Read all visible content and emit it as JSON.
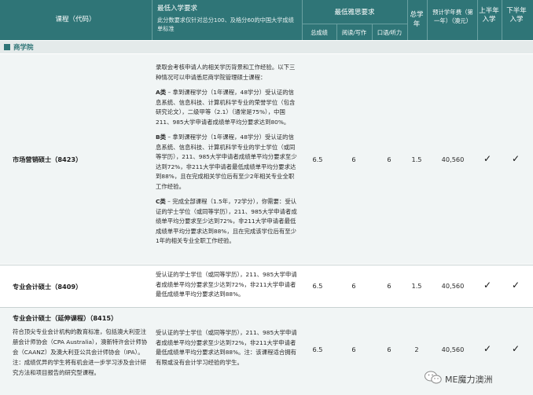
{
  "header": {
    "program": "课程（代码）",
    "min_entry": "最低入学要求",
    "min_entry_note": "此分数要求仅针对总分100、及格分60的中国大学成绩单标准",
    "ielts": "最低雅思要求",
    "overall": "总成绩",
    "reading_writing": "阅读/写作",
    "listening_speaking": "口语/听力",
    "total_years": "总学年",
    "tuition": "预计学年费（第一年）（澳元）",
    "h1": "上半年入学",
    "h2": "下半年入学"
  },
  "section": "商学院",
  "rows": [
    {
      "name": "市场营销硕士（8423）",
      "req_intro": "录取会考核申请人的相关学历背景和工作经验。以下三种情况可以申请悉尼商学院管理硕士课程：",
      "req_a_label": "A类",
      "req_a": " – 拿到课程学分（1年课程，48学分）受认证的信息系统、信息科技、计算机科学专业的荣誉学位（包含研究论文），二级甲等（2.1）（通常是75%），中国211、985大学申请者成绩单平均分要求达到80%。",
      "req_b_label": "B类",
      "req_b": " – 拿到课程学分（1年课程，48学分）受认证的信息系统、信息科技、计算机科学专业的学士学位（或同等学历），211、985大学申请者成绩单平均分要求至少达到72%，非211大学申请者最低成绩单平均分要求达到88%，且在完成相关学位后有至少2年相关专业全职工作经验。",
      "req_c_label": "C类",
      "req_c": " – 完成全部课程（1.5年，72学分），你需要：受认证的学士学位（或同等学历），211、985大学申请者成绩单平均分要求至少达到72%，非211大学申请者最低成绩单平均分要求达到88%，且在完成该学位后有至少1年的相关专业全职工作经验。",
      "overall": "6.5",
      "rw": "6",
      "ls": "6",
      "years": "1.5",
      "fee": "40,560",
      "h1": "✓",
      "h2": "✓"
    },
    {
      "name": "专业会计硕士（8409）",
      "req": "受认证的学士学位（或同等学历），211、985大学申请者成绩单平均分要求至少达到72%，非211大学申请者最低成绩单平均分要求达到88%。",
      "overall": "6.5",
      "rw": "6",
      "ls": "6",
      "years": "1.5",
      "fee": "40,560",
      "h1": "✓",
      "h2": "✓"
    },
    {
      "name": "专业会计硕士（延伸课程）（8415）",
      "desc": "符合顶尖专业会计机构的教育标准，包括澳大利亚注册会计师协会（CPA Australia），澳新特许会计师协会（CAANZ）及澳大利亚公共会计师协会（IPA）。注：成绩优异的学生将有机会进一步学习涉及会计研究方法和项目报告的研究型课程。",
      "req": "受认证的学士学位（或同等学历），211、985大学申请者成绩单平均分要求至少达到72%，非211大学申请者最低成绩单平均分要求达到88%。注：该课程适合拥有有限或没有会计学习经验的学生。",
      "overall": "6.5",
      "rw": "6",
      "ls": "6",
      "years": "2",
      "fee": "40,560",
      "h1": "✓",
      "h2": "✓"
    }
  ],
  "watermark": "ME魔力澳洲"
}
